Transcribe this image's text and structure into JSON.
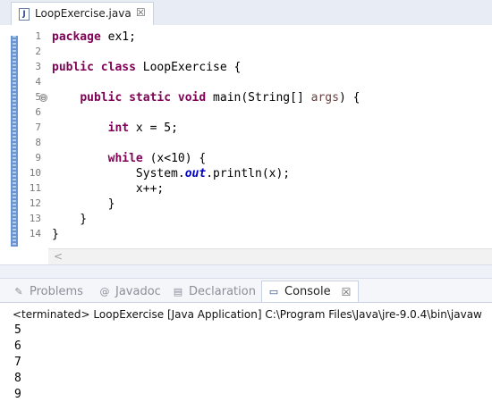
{
  "editor": {
    "tab_title": "LoopExercise.java",
    "tab_icon": "java-file-icon",
    "tab_icon_glyph": "J",
    "close_glyph": "☒",
    "scroll_left_glyph": "<",
    "line_numbers": [
      "1",
      "2",
      "3",
      "4",
      "5",
      "6",
      "7",
      "8",
      "9",
      "10",
      "11",
      "12",
      "13",
      "14"
    ],
    "fold_glyph": "⊖",
    "code_lines": [
      "package ex1;",
      "",
      "public class LoopExercise {",
      "",
      "    public static void main(String[] args) {",
      "",
      "        int x = 5;",
      "",
      "        while (x<10) {",
      "            System.out.println(x);",
      "            x++;",
      "        }",
      "    }",
      "}"
    ],
    "colors": {
      "keyword": "#7f0055",
      "static_field": "#0000c0",
      "line_ruler": "#6a94d4"
    }
  },
  "views": {
    "tabs": [
      {
        "label": "Problems",
        "icon": "problems-icon",
        "glyph": "✎",
        "active": false
      },
      {
        "label": "Javadoc",
        "icon": "javadoc-icon",
        "glyph": "@",
        "active": false
      },
      {
        "label": "Declaration",
        "icon": "declaration-icon",
        "glyph": "▤",
        "active": false
      },
      {
        "label": "Console",
        "icon": "console-icon",
        "glyph": "▭",
        "active": true
      }
    ],
    "console_close_glyph": "☒"
  },
  "console": {
    "header": "<terminated> LoopExercise [Java Application] C:\\Program Files\\Java\\jre-9.0.4\\bin\\javaw",
    "output": [
      "5",
      "6",
      "7",
      "8",
      "9"
    ]
  }
}
